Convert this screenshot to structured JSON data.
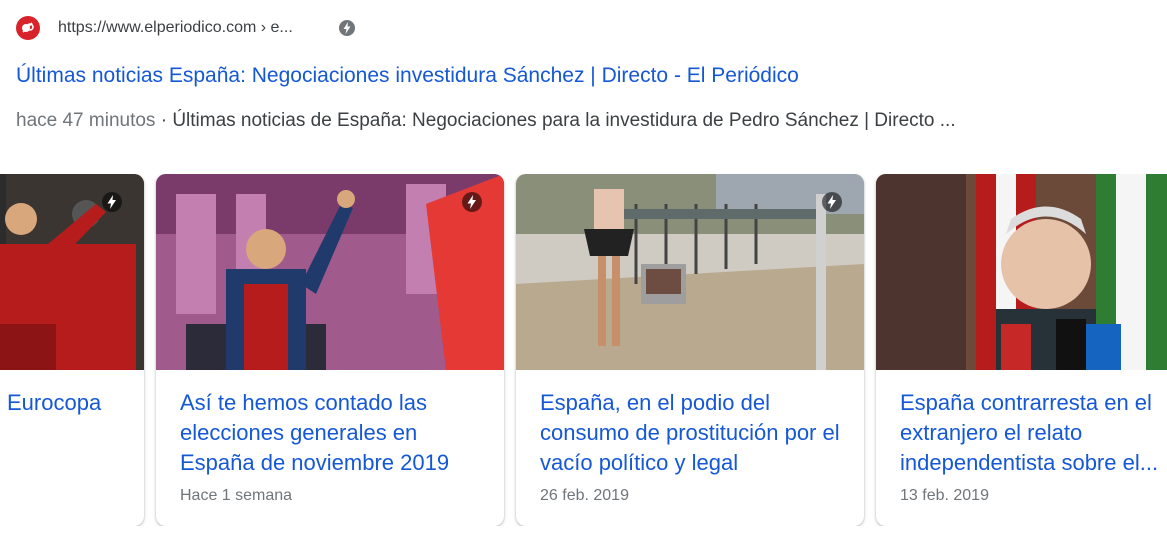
{
  "result": {
    "url": "https://www.elperiodico.com › e...",
    "title": "Últimas noticias España: Negociaciones investidura Sánchez | Directo - El Periódico",
    "snippet_time": "hace 47 minutos",
    "snippet_sep": " · ",
    "snippet_text": "Últimas noticias de España: Negociaciones para la investidura de Pedro Sánchez | Directo ...",
    "favicon_icon": "el-periodico-logo-icon",
    "amp_icon": "amp-lightning-icon"
  },
  "carousel": {
    "cards": [
      {
        "headline": "Eurocopa",
        "date": ""
      },
      {
        "headline": "Así te hemos contado las elecciones generales en España de noviembre 2019",
        "date": "Hace 1 semana"
      },
      {
        "headline": "España, en el podio del consumo de prostitución por el vacío político y legal",
        "date": "26 feb. 2019"
      },
      {
        "headline": "España contrarresta en el extranjero el relato independentista sobre el...",
        "date": "13 feb. 2019"
      }
    ]
  },
  "colors": {
    "link": "#1558d6",
    "text": "#3c4043",
    "muted": "#70757a",
    "brand_red": "#d8232a"
  }
}
